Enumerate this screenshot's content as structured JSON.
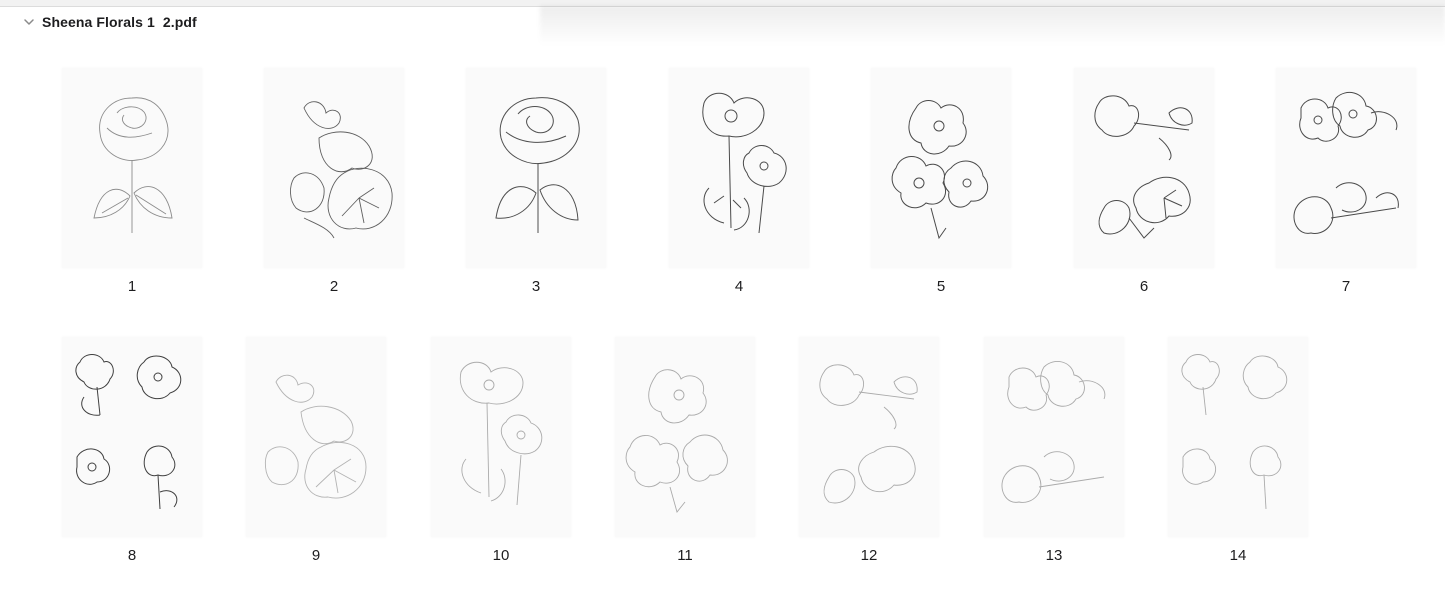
{
  "document": {
    "title": "Sheena Florals 1  2.pdf"
  },
  "pages": {
    "p1": {
      "number": "1"
    },
    "p2": {
      "number": "2"
    },
    "p3": {
      "number": "3"
    },
    "p4": {
      "number": "4"
    },
    "p5": {
      "number": "5"
    },
    "p6": {
      "number": "6"
    },
    "p7": {
      "number": "7"
    },
    "p8": {
      "number": "8"
    },
    "p9": {
      "number": "9"
    },
    "p10": {
      "number": "10"
    },
    "p11": {
      "number": "11"
    },
    "p12": {
      "number": "12"
    },
    "p13": {
      "number": "13"
    },
    "p14": {
      "number": "14"
    }
  },
  "icons": {
    "disclosure": "chevron-down-icon",
    "thumbnail_art": "flower-sketch"
  },
  "colors": {
    "sketch_stroke": "#6e6e6e",
    "thumb_background": "#fafafa",
    "text": "#1d1d1f"
  }
}
